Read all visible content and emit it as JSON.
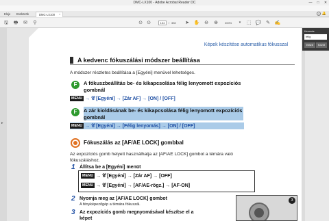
{
  "window": {
    "title": "DMC-LX100 - Adobe Acrobat Reader DC",
    "minimize": "—",
    "maximize": "□",
    "close": "✕"
  },
  "menu": [
    "Fájl",
    "Szerkesztés",
    "Nézet",
    "Ablak",
    "Súgó"
  ],
  "tabs": {
    "home": "Eleje",
    "tools": "Eszközök",
    "doc": "DMC-LX100",
    "doc_close": "×"
  },
  "toolbar": {
    "page_current": "134",
    "page_sep": "/",
    "page_total": "330",
    "zoom": "200%"
  },
  "search": {
    "label": "Keresés",
    "value": "félig",
    "prev": "Előző",
    "next": "Követ"
  },
  "doc": {
    "section_link": "Képek készítése automatikus fókusszal",
    "heading": "A kedvenc fókuszálási módszer beállítása",
    "intro": "A módszer részletes beállítása a [Egyéni] menüvel lehetséges.",
    "item1_icon": "F",
    "item1_title_l1": "A fókuszbeállítás be- és kikapcsolása félig lenyomott expozíciós",
    "item1_title_l2": "gombnál",
    "item1_menu": "MENU",
    "item1_path": "→ 𝒞 [Egyéni] → [Zár AF] → [ON] / [OFF]",
    "item2_icon": "F",
    "item2_title_l1": "A zár kioldásának be- és kikapcsolása félig lenyomott expozíciós",
    "item2_title_l2": "gombnál",
    "item2_menu": "MENU",
    "item2_path": "→ 𝒞 [Egyéni] → [Félig lenyomás] → [ON] / [OFF]",
    "sub_heading": "Fókuszálás az [AF/AE LOCK] gombbal",
    "sub_text_l1": "Az expozíciós gomb helyett használhatja az [AF/AE LOCK] gombot a témára való",
    "sub_text_l2": "fókuszáláshoz.",
    "step1_num": "1",
    "step1_title": "Állítsa be a [Egyéni] menüt",
    "step1_menu": "MENU",
    "step1_line1": "→ 𝒞 [Egyéni] → [Zár AF] → [OFF]",
    "step1_line2": "→ 𝒞 [Egyéni] → [AF/AE-rögz.] → [AF-ON]",
    "step2_num": "2",
    "step2_title": "Nyomja meg az [AF/AE LOCK] gombot",
    "step2_sub": "A fényképezőgép a témára fókuszál.",
    "step3_num": "3",
    "step3_title_l1": "Az expozíciós gomb megnyomásával készítse el a",
    "step3_title_l2": "képet",
    "camera_badge": "3"
  },
  "colors": {
    "accent_blue": "#1f4fa3",
    "highlight": "#aacbe8",
    "green_icon": "#2e9a2e",
    "orange_icon": "#e07020"
  }
}
